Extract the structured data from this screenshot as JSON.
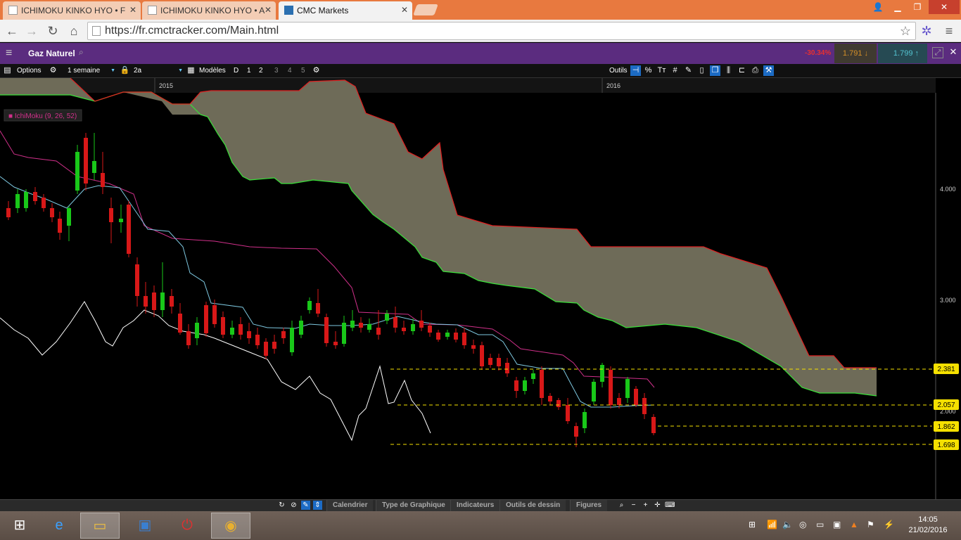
{
  "browser": {
    "tabs": [
      {
        "label": "ICHIMOKU KINKO HYO • F"
      },
      {
        "label": "ICHIMOKU KINKO HYO • A"
      },
      {
        "label": "CMC Markets"
      }
    ],
    "url": "https://fr.cmctracker.com/Main.html"
  },
  "app": {
    "instrument": "Gaz Naturel",
    "change_pct": "-30.34%",
    "bid": "1.791",
    "ask": "1.799",
    "colors": {
      "header": "#5b2c7f",
      "negative": "#e83030",
      "bid": "#d48f28",
      "ask": "#53c3d0"
    }
  },
  "toolbar": {
    "options_label": "Options",
    "interval": "1 semaine",
    "range": "2a",
    "models_label": "Modèles",
    "layout_buttons": [
      "D",
      "1",
      "2",
      "3",
      "4",
      "5"
    ],
    "tools_label": "Outils"
  },
  "chart": {
    "indicator_label": "■ IchiMoku (9, 26, 52)",
    "year_labels": [
      "2015",
      "2016"
    ],
    "y_ticks": [
      "4.000",
      "3.000"
    ],
    "price_tags": [
      "2.381",
      "2.057",
      "1.862",
      "1.698"
    ],
    "hidden_tag": "2.000",
    "colors": {
      "up": "#19c819",
      "down": "#d81818",
      "kumo": "#6e6b58",
      "tenkan": "#7ec8e0",
      "kijun": "#d0308a",
      "chikou": "#ffffff",
      "lines": "#f5e000"
    }
  },
  "bottom_tabs": [
    "Calendrier",
    "Type de Graphique",
    "Indicateurs",
    "Outils de dessin",
    "Figures"
  ],
  "taskbar": {
    "time": "14:05",
    "date": "21/02/2016"
  }
}
